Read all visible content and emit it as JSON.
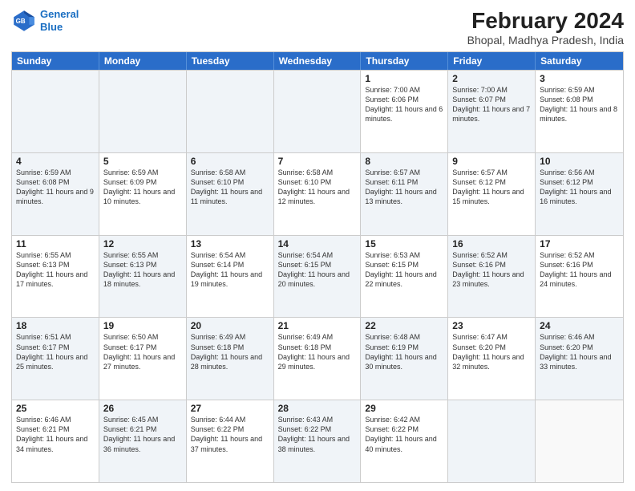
{
  "header": {
    "logo_line1": "General",
    "logo_line2": "Blue",
    "month_title": "February 2024",
    "location": "Bhopal, Madhya Pradesh, India"
  },
  "days_of_week": [
    "Sunday",
    "Monday",
    "Tuesday",
    "Wednesday",
    "Thursday",
    "Friday",
    "Saturday"
  ],
  "rows": [
    [
      {
        "day": "",
        "info": "",
        "shaded": true
      },
      {
        "day": "",
        "info": "",
        "shaded": true
      },
      {
        "day": "",
        "info": "",
        "shaded": true
      },
      {
        "day": "",
        "info": "",
        "shaded": true
      },
      {
        "day": "1",
        "info": "Sunrise: 7:00 AM\nSunset: 6:06 PM\nDaylight: 11 hours\nand 6 minutes."
      },
      {
        "day": "2",
        "info": "Sunrise: 7:00 AM\nSunset: 6:07 PM\nDaylight: 11 hours\nand 7 minutes.",
        "shaded": true
      },
      {
        "day": "3",
        "info": "Sunrise: 6:59 AM\nSunset: 6:08 PM\nDaylight: 11 hours\nand 8 minutes."
      }
    ],
    [
      {
        "day": "4",
        "info": "Sunrise: 6:59 AM\nSunset: 6:08 PM\nDaylight: 11 hours\nand 9 minutes.",
        "shaded": true
      },
      {
        "day": "5",
        "info": "Sunrise: 6:59 AM\nSunset: 6:09 PM\nDaylight: 11 hours\nand 10 minutes."
      },
      {
        "day": "6",
        "info": "Sunrise: 6:58 AM\nSunset: 6:10 PM\nDaylight: 11 hours\nand 11 minutes.",
        "shaded": true
      },
      {
        "day": "7",
        "info": "Sunrise: 6:58 AM\nSunset: 6:10 PM\nDaylight: 11 hours\nand 12 minutes."
      },
      {
        "day": "8",
        "info": "Sunrise: 6:57 AM\nSunset: 6:11 PM\nDaylight: 11 hours\nand 13 minutes.",
        "shaded": true
      },
      {
        "day": "9",
        "info": "Sunrise: 6:57 AM\nSunset: 6:12 PM\nDaylight: 11 hours\nand 15 minutes."
      },
      {
        "day": "10",
        "info": "Sunrise: 6:56 AM\nSunset: 6:12 PM\nDaylight: 11 hours\nand 16 minutes.",
        "shaded": true
      }
    ],
    [
      {
        "day": "11",
        "info": "Sunrise: 6:55 AM\nSunset: 6:13 PM\nDaylight: 11 hours\nand 17 minutes."
      },
      {
        "day": "12",
        "info": "Sunrise: 6:55 AM\nSunset: 6:13 PM\nDaylight: 11 hours\nand 18 minutes.",
        "shaded": true
      },
      {
        "day": "13",
        "info": "Sunrise: 6:54 AM\nSunset: 6:14 PM\nDaylight: 11 hours\nand 19 minutes."
      },
      {
        "day": "14",
        "info": "Sunrise: 6:54 AM\nSunset: 6:15 PM\nDaylight: 11 hours\nand 20 minutes.",
        "shaded": true
      },
      {
        "day": "15",
        "info": "Sunrise: 6:53 AM\nSunset: 6:15 PM\nDaylight: 11 hours\nand 22 minutes."
      },
      {
        "day": "16",
        "info": "Sunrise: 6:52 AM\nSunset: 6:16 PM\nDaylight: 11 hours\nand 23 minutes.",
        "shaded": true
      },
      {
        "day": "17",
        "info": "Sunrise: 6:52 AM\nSunset: 6:16 PM\nDaylight: 11 hours\nand 24 minutes."
      }
    ],
    [
      {
        "day": "18",
        "info": "Sunrise: 6:51 AM\nSunset: 6:17 PM\nDaylight: 11 hours\nand 25 minutes.",
        "shaded": true
      },
      {
        "day": "19",
        "info": "Sunrise: 6:50 AM\nSunset: 6:17 PM\nDaylight: 11 hours\nand 27 minutes."
      },
      {
        "day": "20",
        "info": "Sunrise: 6:49 AM\nSunset: 6:18 PM\nDaylight: 11 hours\nand 28 minutes.",
        "shaded": true
      },
      {
        "day": "21",
        "info": "Sunrise: 6:49 AM\nSunset: 6:18 PM\nDaylight: 11 hours\nand 29 minutes."
      },
      {
        "day": "22",
        "info": "Sunrise: 6:48 AM\nSunset: 6:19 PM\nDaylight: 11 hours\nand 30 minutes.",
        "shaded": true
      },
      {
        "day": "23",
        "info": "Sunrise: 6:47 AM\nSunset: 6:20 PM\nDaylight: 11 hours\nand 32 minutes."
      },
      {
        "day": "24",
        "info": "Sunrise: 6:46 AM\nSunset: 6:20 PM\nDaylight: 11 hours\nand 33 minutes.",
        "shaded": true
      }
    ],
    [
      {
        "day": "25",
        "info": "Sunrise: 6:46 AM\nSunset: 6:21 PM\nDaylight: 11 hours\nand 34 minutes."
      },
      {
        "day": "26",
        "info": "Sunrise: 6:45 AM\nSunset: 6:21 PM\nDaylight: 11 hours\nand 36 minutes.",
        "shaded": true
      },
      {
        "day": "27",
        "info": "Sunrise: 6:44 AM\nSunset: 6:22 PM\nDaylight: 11 hours\nand 37 minutes."
      },
      {
        "day": "28",
        "info": "Sunrise: 6:43 AM\nSunset: 6:22 PM\nDaylight: 11 hours\nand 38 minutes.",
        "shaded": true
      },
      {
        "day": "29",
        "info": "Sunrise: 6:42 AM\nSunset: 6:22 PM\nDaylight: 11 hours\nand 40 minutes."
      },
      {
        "day": "",
        "info": "",
        "shaded": true
      },
      {
        "day": "",
        "info": "",
        "shaded": false
      }
    ]
  ]
}
